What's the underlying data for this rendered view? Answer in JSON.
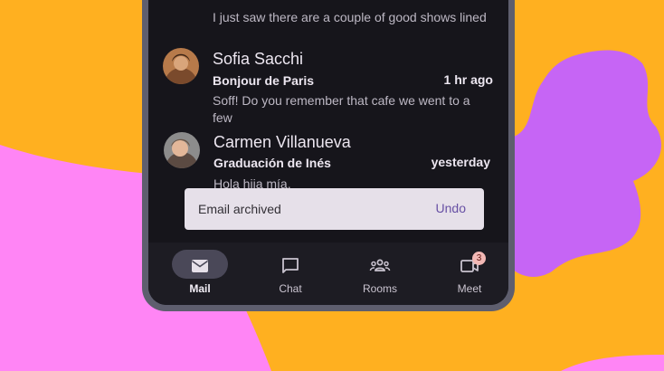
{
  "email_list": {
    "partial_snippet": "I just saw there are a couple of good shows lined",
    "items": [
      {
        "sender": "Sofia Sacchi",
        "subject": "Bonjour de Paris",
        "time": "1 hr ago",
        "snippet_line1": "Soff! Do you remember that cafe we went to a",
        "snippet_line2": "few"
      },
      {
        "sender": "Carmen Villanueva",
        "subject": "Graduación de Inés",
        "time": "yesterday",
        "snippet_line1": "Hola hija mía,"
      }
    ]
  },
  "snackbar": {
    "message": "Email archived",
    "action": "Undo"
  },
  "navbar": {
    "items": [
      {
        "label": "Mail",
        "icon": "mail-icon",
        "active": true
      },
      {
        "label": "Chat",
        "icon": "chat-icon",
        "active": false
      },
      {
        "label": "Rooms",
        "icon": "rooms-icon",
        "active": false
      },
      {
        "label": "Meet",
        "icon": "meet-icon",
        "active": false,
        "badge": "3"
      }
    ]
  },
  "colors": {
    "background_orange": "#FFB020",
    "background_pink": "#FF85F5",
    "background_purple": "#C665F5",
    "screen": "#16151B",
    "accent": "#6750A4"
  }
}
